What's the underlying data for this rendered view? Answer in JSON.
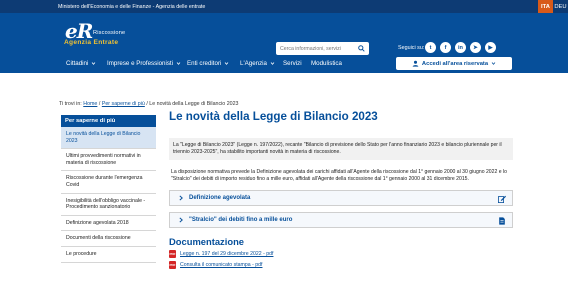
{
  "topbar": {
    "ministry_link": "Ministero dell'Economia e delle Finanze - Agenzia delle entrate",
    "languages": [
      "ITA",
      "DEU"
    ]
  },
  "header": {
    "logo_mark": "eR",
    "logo_sub": "Riscossione",
    "logo_agency": "Agenzia Entrate",
    "search_placeholder": "Cerca informazioni, servizi",
    "follow_us": "Seguici su:",
    "social": [
      {
        "icon": "twitter-icon",
        "glyph": "t"
      },
      {
        "icon": "facebook-icon",
        "glyph": "f"
      },
      {
        "icon": "linkedin-icon",
        "glyph": "in"
      },
      {
        "icon": "telegram-icon",
        "glyph": "➤"
      },
      {
        "icon": "youtube-icon",
        "glyph": "▶"
      }
    ]
  },
  "nav": {
    "items": [
      "Cittadini",
      "Imprese e Professionisti",
      "Enti creditori",
      "L'Agenzia",
      "Servizi",
      "Modulistica"
    ],
    "access_button": "Accedi all'area riservata"
  },
  "breadcrumb": {
    "prefix": "Ti trovi in:",
    "home": "Home",
    "section": "Per saperne di più",
    "current": "Le novità della Legge di Bilancio 2023"
  },
  "sidebar": {
    "heading": "Per saperne di più",
    "items": [
      "Le novità della Legge di Bilancio 2023",
      "Ultimi provvedimenti normativi in materia di riscossione",
      "Riscossione durante l'emergenza Covid",
      "Inesigibilità dell'obbligo vaccinale - Procedimento sanzionatorio",
      "Definizione agevolata 2018",
      "Documenti della riscossione",
      "Le procedure"
    ]
  },
  "main": {
    "title": "Le novità della Legge di Bilancio 2023",
    "intro": "La \"Legge di Bilancio 2023\" (Legge n. 197/2022), recante \"Bilancio di previsione dello Stato per l'anno finanziario 2023 e bilancio pluriennale per il triennio 2023-2025\", ha stabilito importanti novità in materia di riscossione.",
    "paragraph": "La disposizione normativa prevede la Definizione agevolata dei carichi affidati all'Agente della riscossione dal 1° gennaio 2000 al 30 giugno 2022 e lo \"Stralcio\" dei debiti di importo residuo fino a mille euro, affidati all'Agente della riscossione dal 1° gennaio 2000 al 31 dicembre 2015.",
    "accordions": [
      {
        "label": "Definizione agevolata",
        "icon": "edit-icon"
      },
      {
        "label": "\"Stralcio\" dei debiti fino a mille euro",
        "icon": "document-icon"
      }
    ],
    "documentation_title": "Documentazione",
    "documents": [
      "Legge n. 197 del 29 dicembre 2022 - pdf",
      "Consulta il comunicato stampa - pdf"
    ],
    "pdf_badge": "PDF"
  },
  "colors": {
    "brand_blue": "#064f9a",
    "topbar_blue": "#0d3b74",
    "accent_orange": "#d85a1a",
    "pdf_red": "#d42525"
  }
}
